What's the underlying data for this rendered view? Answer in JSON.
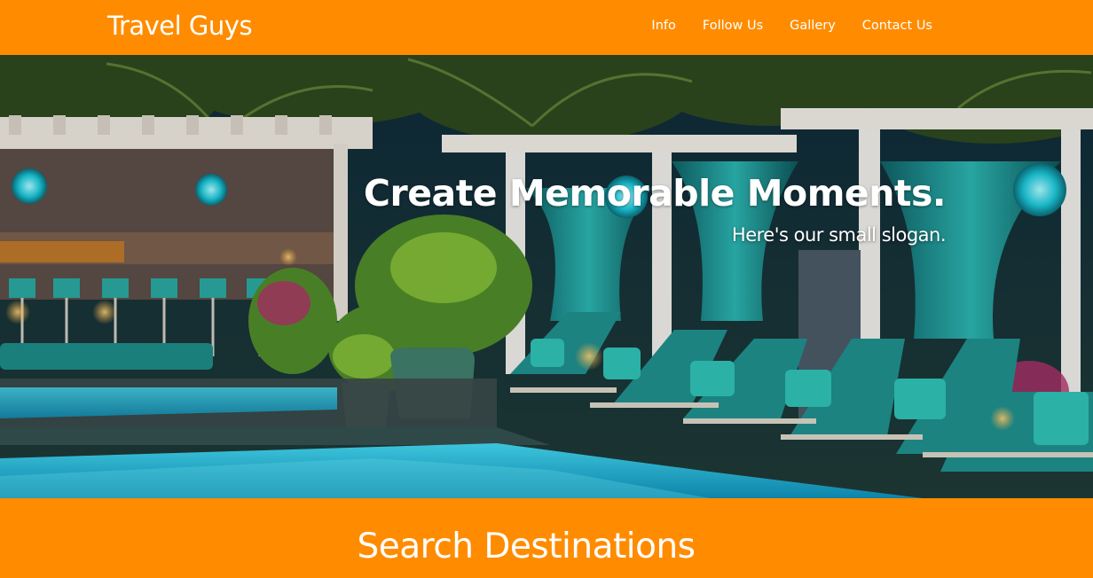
{
  "brand": {
    "name": "Travel Guys"
  },
  "nav": {
    "items": [
      {
        "label": "Info"
      },
      {
        "label": "Follow Us"
      },
      {
        "label": "Gallery"
      },
      {
        "label": "Contact Us"
      }
    ]
  },
  "hero": {
    "title": "Create Memorable Moments.",
    "slogan": "Here's our small slogan."
  },
  "search": {
    "heading": "Search Destinations"
  },
  "colors": {
    "accent": "#ff8c00",
    "text": "#ffffff",
    "pool": "#2fc4e0",
    "cushion": "#2aa6a0"
  }
}
